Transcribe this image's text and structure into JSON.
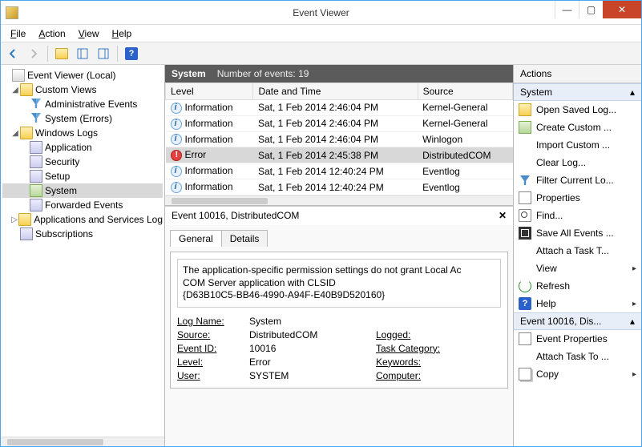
{
  "window": {
    "title": "Event Viewer"
  },
  "menu": {
    "file": "File",
    "action": "Action",
    "view": "View",
    "help": "Help"
  },
  "tree": {
    "root": "Event Viewer (Local)",
    "custom": "Custom Views",
    "admin": "Administrative Events",
    "syserr": "System (Errors)",
    "winlogs": "Windows Logs",
    "app": "Application",
    "sec": "Security",
    "setup": "Setup",
    "system": "System",
    "forward": "Forwarded Events",
    "appserv": "Applications and Services Log",
    "subs": "Subscriptions"
  },
  "header": {
    "title": "System",
    "count": "Number of events: 19"
  },
  "cols": {
    "level": "Level",
    "date": "Date and Time",
    "source": "Source"
  },
  "rows": [
    {
      "lvl": "Information",
      "ic": "info",
      "date": "Sat, 1 Feb 2014 2:46:04 PM",
      "src": "Kernel-General"
    },
    {
      "lvl": "Information",
      "ic": "info",
      "date": "Sat, 1 Feb 2014 2:46:04 PM",
      "src": "Kernel-General"
    },
    {
      "lvl": "Information",
      "ic": "info",
      "date": "Sat, 1 Feb 2014 2:46:04 PM",
      "src": "Winlogon"
    },
    {
      "lvl": "Error",
      "ic": "err",
      "date": "Sat, 1 Feb 2014 2:45:38 PM",
      "src": "DistributedCOM"
    },
    {
      "lvl": "Information",
      "ic": "info",
      "date": "Sat, 1 Feb 2014 12:40:24 PM",
      "src": "Eventlog"
    },
    {
      "lvl": "Information",
      "ic": "info",
      "date": "Sat, 1 Feb 2014 12:40:24 PM",
      "src": "Eventlog"
    }
  ],
  "detail": {
    "title": "Event 10016, DistributedCOM",
    "tabs": {
      "general": "General",
      "details": "Details"
    },
    "msg_l1": "The application-specific permission settings do not grant Local Ac",
    "msg_l2": "COM Server application with CLSID",
    "msg_l3": "{D63B10C5-BB46-4990-A94F-E40B9D520160}",
    "kv": {
      "logname_k": "Log Name:",
      "logname_v": "System",
      "source_k": "Source:",
      "source_v": "DistributedCOM",
      "logged_k": "Logged:",
      "eventid_k": "Event ID:",
      "eventid_v": "10016",
      "taskcat_k": "Task Category:",
      "level_k": "Level:",
      "level_v": "Error",
      "keywords_k": "Keywords:",
      "user_k": "User:",
      "user_v": "SYSTEM",
      "computer_k": "Computer:"
    }
  },
  "actions": {
    "title": "Actions",
    "group1": "System",
    "items1": [
      "Open Saved Log...",
      "Create Custom ...",
      "Import Custom ...",
      "Clear Log...",
      "Filter Current Lo...",
      "Properties",
      "Find...",
      "Save All Events ...",
      "Attach a Task T...",
      "View",
      "Refresh",
      "Help"
    ],
    "group2": "Event 10016, Dis...",
    "items2": [
      "Event Properties",
      "Attach Task To ...",
      "Copy"
    ]
  }
}
